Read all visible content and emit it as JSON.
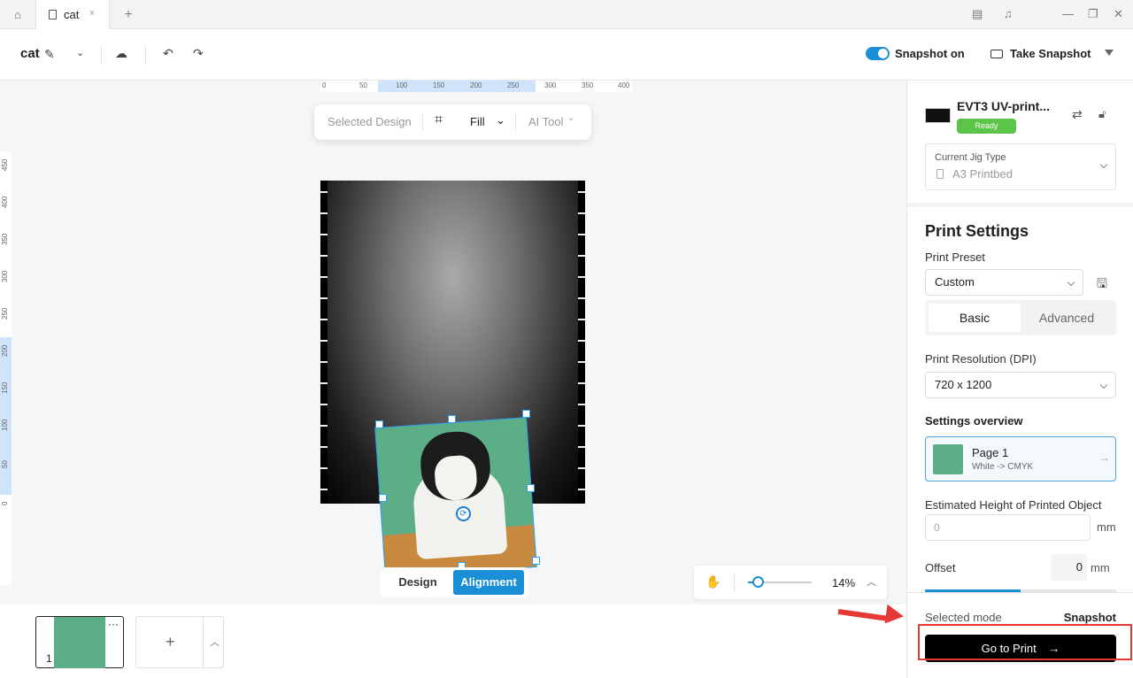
{
  "tabbar": {
    "home_icon": "home-icon",
    "tab_label": "cat",
    "tab_close": "×",
    "new_tab": "+",
    "window_icons": [
      "clipboard-icon",
      "bell-icon",
      "minimize-icon",
      "restore-icon",
      "close-icon"
    ],
    "controls": [
      "—",
      "❐",
      "✕"
    ]
  },
  "toolbar": {
    "project_name": "cat",
    "snapshot_label": "Snapshot on",
    "take_snapshot": "Take Snapshot"
  },
  "canvas": {
    "hruler": [
      "0",
      "50",
      "100",
      "150",
      "200",
      "250",
      "300",
      "350",
      "400"
    ],
    "vruler": [
      "450",
      "400",
      "350",
      "300",
      "250",
      "200",
      "150",
      "100",
      "50",
      "0"
    ],
    "floatbar": {
      "selected_design": "Selected Design",
      "fill": "Fill",
      "ai_tool": "AI Tool"
    },
    "mode_tabs": {
      "design": "Design",
      "alignment": "Alignment"
    },
    "zoom": "14%"
  },
  "pages": {
    "page_number": "1",
    "more": "···",
    "add": "+"
  },
  "panel": {
    "device_name": "EVT3 UV-print...",
    "status": "Ready",
    "jig_label": "Current Jig Type",
    "jig_value": "A3 Printbed",
    "print_settings": "Print Settings",
    "print_preset_label": "Print Preset",
    "print_preset_value": "Custom",
    "tabs": {
      "basic": "Basic",
      "advanced": "Advanced"
    },
    "resolution_label": "Print Resolution (DPI)",
    "resolution_value": "720 x 1200",
    "overview_label": "Settings overview",
    "page_title": "Page 1",
    "page_sub": "White -> CMYK",
    "height_label": "Estimated Height of Printed Object",
    "height_placeholder": "0",
    "height_unit": "mm",
    "offset_label": "Offset",
    "offset_value": "0",
    "offset_unit": "mm",
    "selected_mode_label": "Selected mode",
    "selected_mode_value": "Snapshot",
    "go_to_print": "Go to Print"
  },
  "colors": {
    "accent": "#1a8fd6",
    "ready": "#5cc449",
    "annotation": "#e53935"
  }
}
